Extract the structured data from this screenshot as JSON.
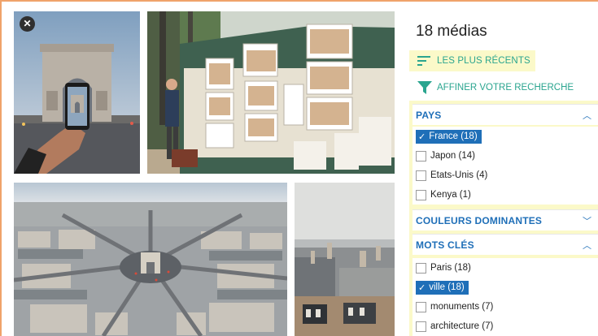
{
  "results": {
    "count_label": "18 médias"
  },
  "sort": {
    "label": "LES PLUS RÉCENTS"
  },
  "refine": {
    "label": "AFFINER VOTRE RECHERCHE"
  },
  "sections": {
    "pays": {
      "title": "PAYS",
      "expanded": true,
      "options": [
        {
          "label": "France (18)",
          "selected": true
        },
        {
          "label": "Japon (14)",
          "selected": false
        },
        {
          "label": "Etats-Unis (4)",
          "selected": false
        },
        {
          "label": "Kenya (1)",
          "selected": false
        }
      ]
    },
    "couleurs": {
      "title": "COULEURS DOMINANTES",
      "expanded": false
    },
    "mots": {
      "title": "MOTS CLÉS",
      "expanded": true,
      "options": [
        {
          "label": "Paris (18)",
          "selected": false
        },
        {
          "label": "ville (18)",
          "selected": true
        },
        {
          "label": "monuments (7)",
          "selected": false
        },
        {
          "label": "architecture (7)",
          "selected": false
        }
      ]
    }
  },
  "colors": {
    "accent_teal": "#2aa58f",
    "accent_blue": "#1f6fb8",
    "highlight": "#fbf9c9"
  },
  "icons": {
    "close": "close-icon",
    "sort": "sort-lines-icon",
    "filter": "funnel-icon",
    "chev_up": "chevron-up-icon",
    "chev_down": "chevron-down-icon"
  }
}
